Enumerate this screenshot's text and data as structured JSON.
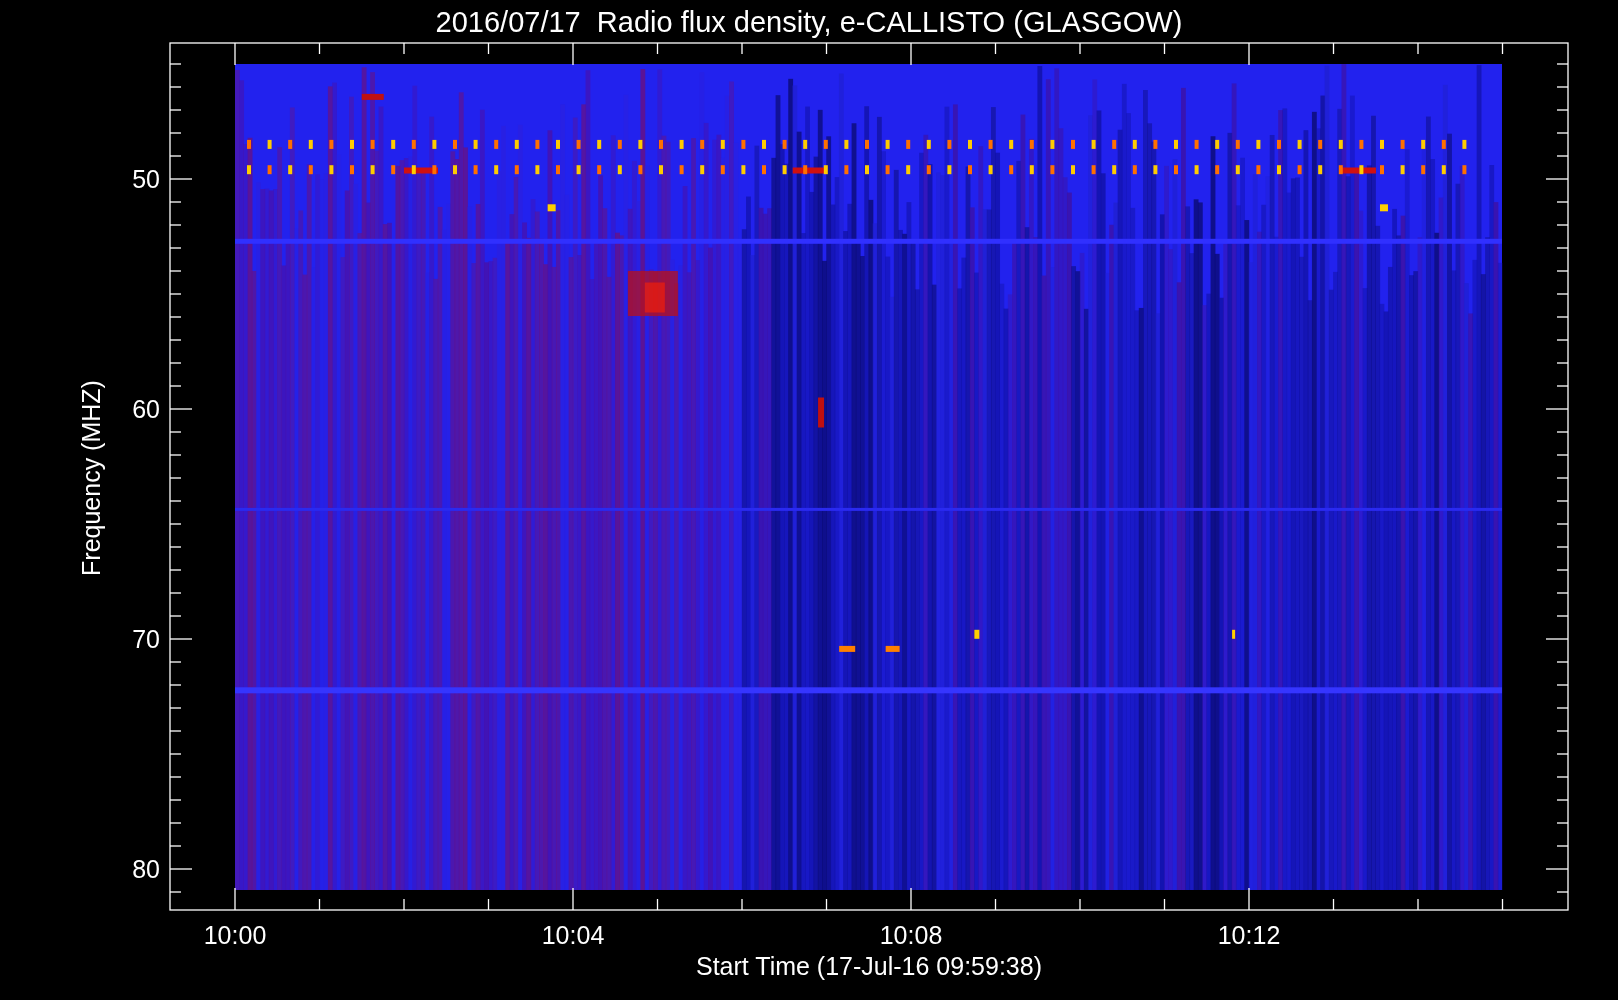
{
  "title": "2016/07/17  Radio flux density, e-CALLISTO (GLASGOW)",
  "plot": {
    "ylabel": "Frequency (MHZ)",
    "xlabel": "Start Time (17-Jul-16 09:59:38)",
    "xtick_labels": [
      "10:00",
      "10:04",
      "10:08",
      "10:12"
    ],
    "ytick_labels": [
      "50",
      "60",
      "70",
      "80"
    ]
  }
}
